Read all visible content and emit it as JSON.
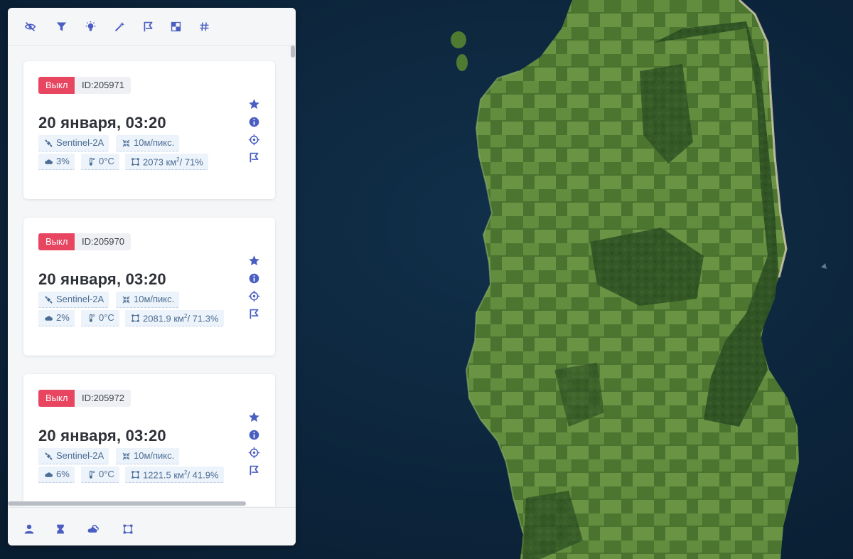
{
  "colors": {
    "accent": "#4a5ec2",
    "status_off": "#e84560",
    "chip_bg": "#edf3fa",
    "chip_text": "#4a6d93",
    "ocean": "#0b2238",
    "land": "#4f7a32"
  },
  "toolbar": {
    "icons": [
      "eye-slash-icon",
      "filter-icon",
      "bulb-icon",
      "magic-wand-icon",
      "flag-icon",
      "checkerboard-icon",
      "hashtag-icon"
    ]
  },
  "cards": [
    {
      "status": "Выкл",
      "id": "ID:205971",
      "date": "20 января, 03:20",
      "satellite": "Sentinel-2A",
      "resolution": "10м/пикс.",
      "cloud": "3%",
      "temperature": "0°C",
      "area": "2073 км",
      "area_unit_sup": "2",
      "coverage": "/ 71%"
    },
    {
      "status": "Выкл",
      "id": "ID:205970",
      "date": "20 января, 03:20",
      "satellite": "Sentinel-2A",
      "resolution": "10м/пикс.",
      "cloud": "2%",
      "temperature": "0°C",
      "area": "2081.9 км",
      "area_unit_sup": "2",
      "coverage": "/ 71.3%"
    },
    {
      "status": "Выкл",
      "id": "ID:205972",
      "date": "20 января, 03:20",
      "satellite": "Sentinel-2A",
      "resolution": "10м/пикс.",
      "cloud": "6%",
      "temperature": "0°C",
      "area": "1221.5 км",
      "area_unit_sup": "2",
      "coverage": "/ 41.9%"
    }
  ],
  "card_actions": [
    "star-icon",
    "info-icon",
    "crosshair-icon",
    "flag-icon"
  ],
  "bottombar": {
    "icons": [
      "user-icon",
      "hourglass-icon",
      "clouds-icon",
      "area-select-icon"
    ]
  }
}
